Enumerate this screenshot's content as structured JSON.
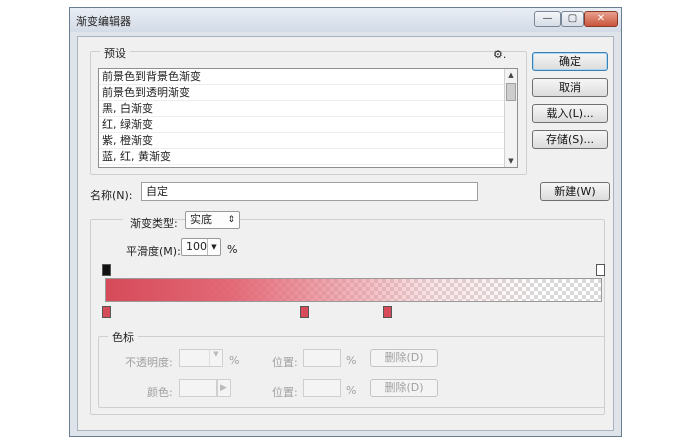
{
  "window": {
    "title": "渐变编辑器",
    "min": "—",
    "max": "▢",
    "close": "✕"
  },
  "presets": {
    "legend": "预设",
    "gear": "⚙.",
    "items": [
      "前景色到背景色渐变",
      "前景色到透明渐变",
      "黑, 白渐变",
      "红, 绿渐变",
      "紫, 橙渐变",
      "蓝, 红, 黄渐变"
    ]
  },
  "buttons": {
    "ok": "确定",
    "cancel": "取消",
    "load": "载入(L)...",
    "save": "存储(S)...",
    "new": "新建(W)"
  },
  "name": {
    "label": "名称(N):",
    "value": "自定"
  },
  "gradient": {
    "type_label": "渐变类型:",
    "type_value": "实底",
    "smooth_label": "平滑度(M):",
    "smooth_value": "100",
    "smooth_unit": "%",
    "colors": {
      "start": "#d64a59",
      "end": "#ffffff"
    }
  },
  "stops_panel": {
    "legend": "色标",
    "opacity_label": "不透明度:",
    "opacity_unit": "%",
    "location_label": "位置:",
    "location_unit": "%",
    "delete_label": "删除(D)",
    "color_label": "颜色:"
  }
}
